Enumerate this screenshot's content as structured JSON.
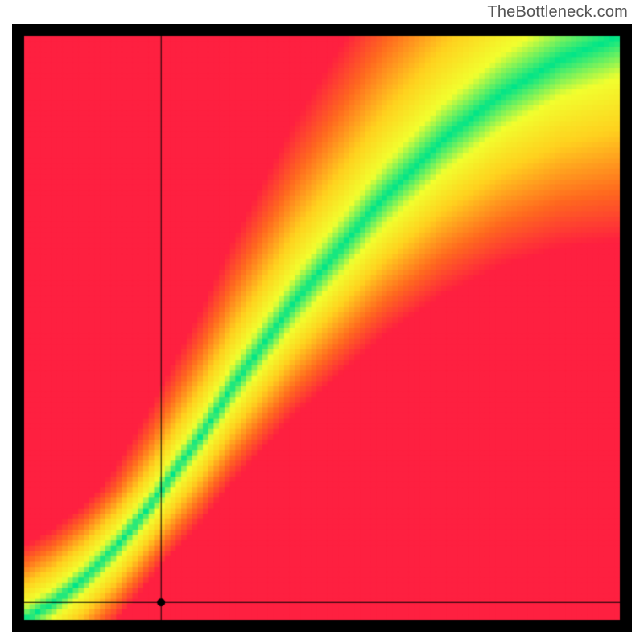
{
  "attribution": "TheBottleneck.com",
  "chart_data": {
    "type": "heatmap",
    "title": "",
    "xlabel": "",
    "ylabel": "",
    "xlim": [
      0,
      100
    ],
    "ylim": [
      0,
      100
    ],
    "grid_resolution": 110,
    "colorscale_description": "red (high bottleneck) → orange → yellow → green (balanced)",
    "optimal_curve": {
      "description": "Points along the balanced performance ridge (green band). Approximate values estimated from the image gradient; x is normalized CPU-like score, y is normalized GPU-like score.",
      "x": [
        0,
        5,
        10,
        15,
        20,
        25,
        30,
        35,
        40,
        45,
        50,
        55,
        60,
        65,
        70,
        75,
        80,
        85,
        90,
        95,
        100
      ],
      "y": [
        0,
        3,
        7,
        12,
        18,
        25,
        32,
        40,
        47,
        54,
        60,
        66,
        72,
        77,
        82,
        86,
        90,
        93,
        96,
        98,
        100
      ]
    },
    "band_halfwidth_percent": 5,
    "marker": {
      "description": "Black reference dot indicating the queried hardware pair",
      "x": 23,
      "y": 3
    },
    "crosshair": {
      "description": "Thin black crosshair lines through the marker",
      "x": 23,
      "y": 3
    },
    "colors": {
      "low": "#fe2040",
      "mid1": "#ff6a1f",
      "mid2": "#ffd21f",
      "yellow": "#f2ff2f",
      "high": "#00e589",
      "frame": "#000000",
      "marker": "#000000"
    }
  }
}
